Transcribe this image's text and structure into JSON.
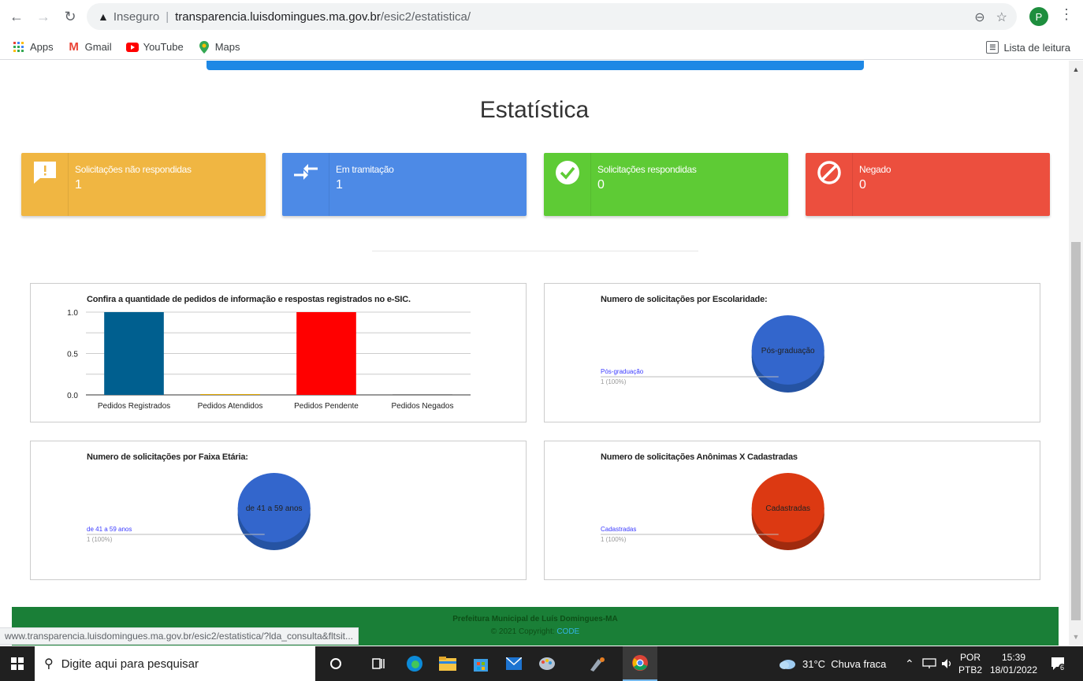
{
  "browser": {
    "security_label": "Inseguro",
    "url_domain": "transparencia.luisdomingues.ma.gov.br",
    "url_path": "/esic2/estatistica/",
    "profile_initial": "P",
    "bookmarks": [
      {
        "label": "Apps"
      },
      {
        "label": "Gmail"
      },
      {
        "label": "YouTube"
      },
      {
        "label": "Maps"
      }
    ],
    "reading_list_label": "Lista de leitura",
    "status_url": "www.transparencia.luisdomingues.ma.gov.br/esic2/estatistica/?lda_consulta&fltsit..."
  },
  "page": {
    "title": "Estatística",
    "cards": [
      {
        "label": "Solicitações não respondidas",
        "value": "1",
        "color": "#f0b642",
        "icon": "alert-message-icon"
      },
      {
        "label": "Em tramitação",
        "value": "1",
        "color": "#4d8ae6",
        "icon": "transfer-arrows-icon"
      },
      {
        "label": "Solicitações respondidas",
        "value": "0",
        "color": "#5ecb35",
        "icon": "check-circle-icon"
      },
      {
        "label": "Negado",
        "value": "0",
        "color": "#ec4f3e",
        "icon": "denied-icon"
      }
    ],
    "footer": {
      "line1": "Prefeitura Municipal de Luís Domingues-MA",
      "line2_prefix": "© 2021 Copyright:",
      "line2_brand": "CODE"
    }
  },
  "chart_data": [
    {
      "type": "bar",
      "title": "Confira a quantidade de pedidos de informação e respostas registrados no e-SIC.",
      "categories": [
        "Pedidos Registrados",
        "Pedidos Atendidos",
        "Pedidos Pendente",
        "Pedidos Negados"
      ],
      "values": [
        1,
        0,
        1,
        0
      ],
      "colors": [
        "#005f8f",
        "#e0a800",
        "#ff0000",
        "#888888"
      ],
      "ylim": [
        0,
        1
      ],
      "yticks": [
        "0.0",
        "0.5",
        "1.0"
      ],
      "grid": true
    },
    {
      "type": "pie",
      "title": "Numero de solicitações por Escolaridade:",
      "labels": [
        "Pós-graduação"
      ],
      "values": [
        1
      ],
      "value_labels": [
        "1 (100%)"
      ],
      "colors": [
        "#3366cc"
      ]
    },
    {
      "type": "pie",
      "title": "Numero de solicitações por Faixa Etária:",
      "labels": [
        "de 41 a 59 anos"
      ],
      "values": [
        1
      ],
      "value_labels": [
        "1 (100%)"
      ],
      "colors": [
        "#3366cc"
      ]
    },
    {
      "type": "pie",
      "title": "Numero de solicitações Anônimas X Cadastradas",
      "labels": [
        "Cadastradas"
      ],
      "values": [
        1
      ],
      "value_labels": [
        "1 (100%)"
      ],
      "colors": [
        "#dc3912"
      ]
    }
  ],
  "taskbar": {
    "search_placeholder": "Digite aqui para pesquisar",
    "weather": "31°C  Chuva fraca",
    "lang_top": "POR",
    "lang_bottom": "PTB2",
    "time": "15:39",
    "date": "18/01/2022",
    "notifications": "6"
  }
}
